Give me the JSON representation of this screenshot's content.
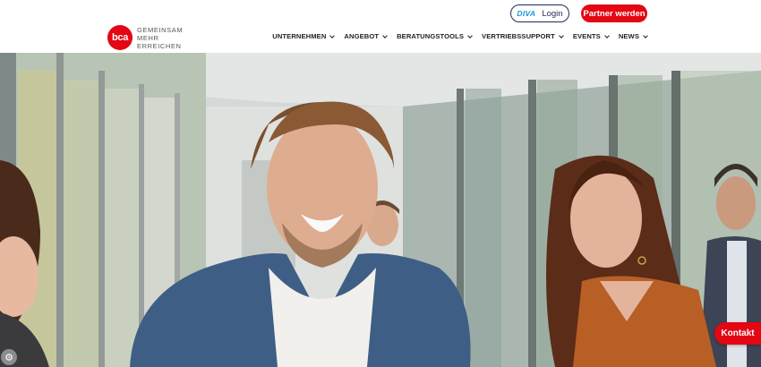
{
  "header": {
    "logo_text": "bca",
    "tagline": [
      "GEMEINSAM",
      "MEHR",
      "ERREICHEN"
    ],
    "diva_label": "DIVA",
    "login_label": "Login",
    "partner_label": "Partner werden",
    "nav": [
      {
        "label": "UNTERNEHMEN"
      },
      {
        "label": "ANGEBOT"
      },
      {
        "label": "BERATUNGSTOOLS"
      },
      {
        "label": "VERTRIEBSSUPPORT"
      },
      {
        "label": "EVENTS"
      },
      {
        "label": "NEWS"
      }
    ]
  },
  "hero": {
    "kontakt_label": "Kontakt",
    "cookie_icon": "gear-icon"
  },
  "colors": {
    "brand_red": "#e30613",
    "diva_blue": "#1a9bd7",
    "navy": "#1e2a5a"
  }
}
